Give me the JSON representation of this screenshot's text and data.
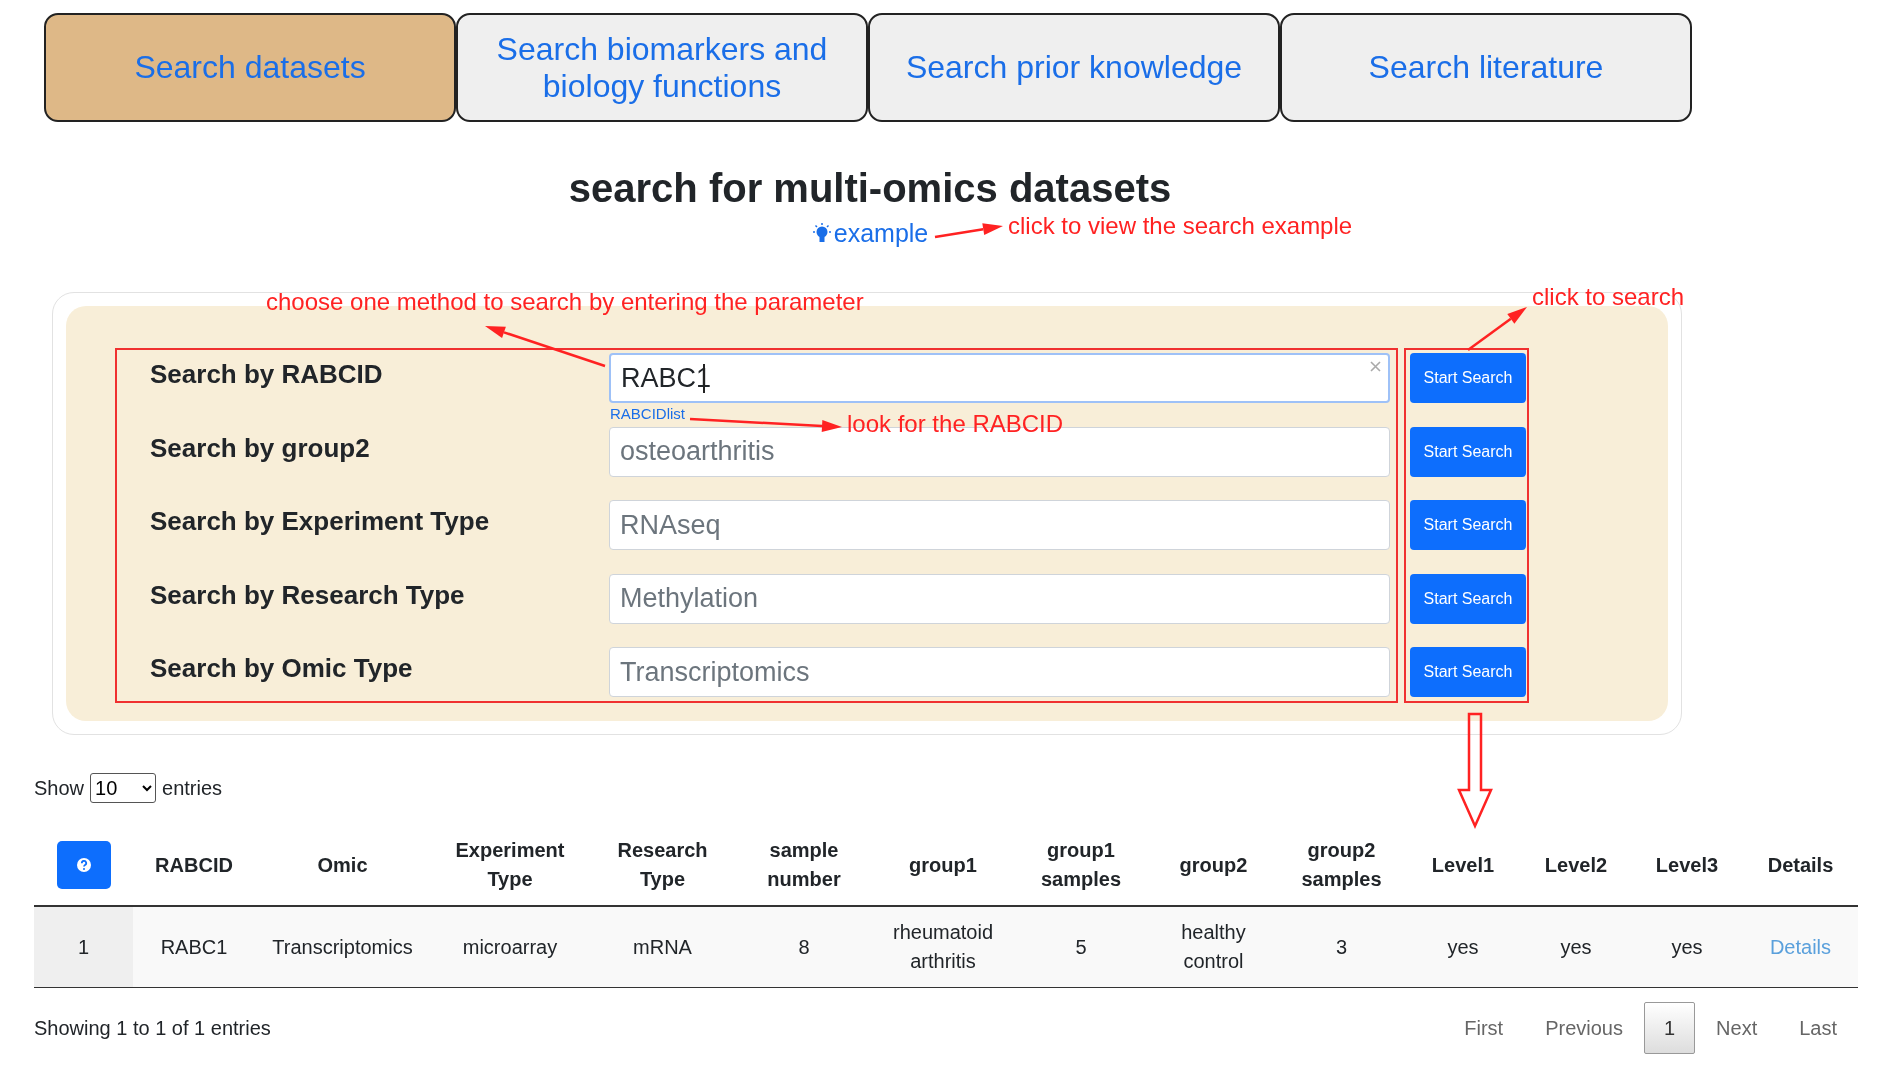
{
  "tabs": [
    {
      "label": "Search datasets",
      "selected": true
    },
    {
      "label": "Search biomarkers and biology functions",
      "selected": false
    },
    {
      "label": "Search prior knowledge",
      "selected": false
    },
    {
      "label": "Search literature",
      "selected": false
    }
  ],
  "title": "search for multi-omics datasets",
  "example_link": "example",
  "search_rows": [
    {
      "label": "Search by RABCID",
      "value": "RABC1",
      "link": "RABCIDlist",
      "button": "Start Search"
    },
    {
      "label": "Search by group2",
      "placeholder": "osteoarthritis",
      "button": "Start Search"
    },
    {
      "label": "Search by Experiment Type",
      "placeholder": "RNAseq",
      "button": "Start Search"
    },
    {
      "label": "Search by Research Type",
      "placeholder": "Methylation",
      "button": "Start Search"
    },
    {
      "label": "Search by Omic Type",
      "placeholder": "Transcriptomics",
      "button": "Start Search"
    }
  ],
  "annotations": [
    "click to view the search example",
    "choose one method to search by entering the parameter",
    "click to search",
    "look for the RABCID"
  ],
  "length_control": {
    "before": "Show",
    "value": "10",
    "after": "entries"
  },
  "table": {
    "columns": [
      "RABCID",
      "Omic",
      "Experiment Type",
      "Research Type",
      "sample number",
      "group1",
      "group1 samples",
      "group2",
      "group2 samples",
      "Level1",
      "Level2",
      "Level3",
      "Details"
    ],
    "rows": [
      {
        "index": "1",
        "cells": [
          "RABC1",
          "Transcriptomics",
          "microarray",
          "mRNA",
          "8",
          "rheumatoid arthritis",
          "5",
          "healthy control",
          "3",
          "yes",
          "yes",
          "yes",
          "Details"
        ]
      }
    ]
  },
  "info": "Showing 1 to 1 of 1 entries",
  "pagination": [
    {
      "label": "First",
      "selected": false
    },
    {
      "label": "Previous",
      "selected": false
    },
    {
      "label": "1",
      "selected": true
    },
    {
      "label": "Next",
      "selected": false
    },
    {
      "label": "Last",
      "selected": false
    }
  ]
}
